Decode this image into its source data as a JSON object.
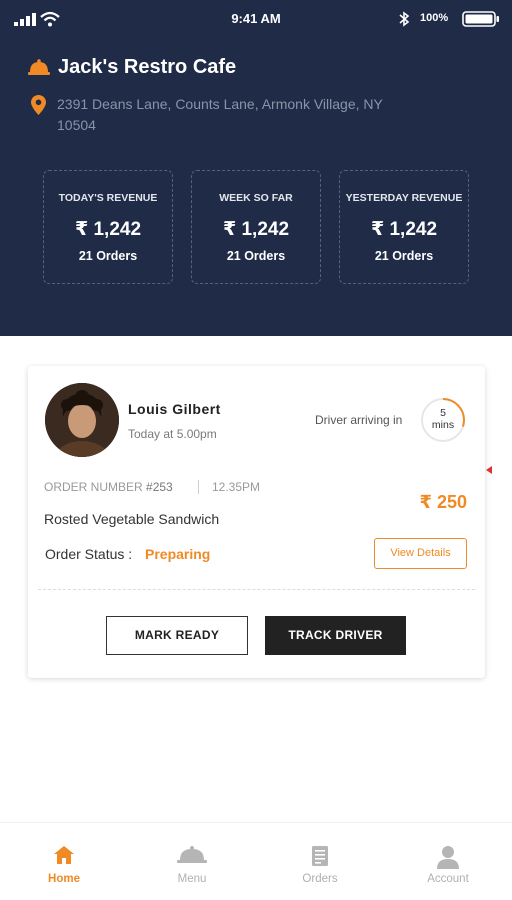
{
  "status_bar": {
    "time": "9:41 AM",
    "battery": "100%",
    "icons": [
      "signal-icon",
      "wifi-icon",
      "bluetooth-icon",
      "battery-icon"
    ]
  },
  "restaurant": {
    "name": "Jack's Restro Cafe",
    "address": "2391 Deans Lane, Counts Lane, Armonk Village, NY 10504",
    "icons": [
      "cloche-icon",
      "location-pin-icon"
    ]
  },
  "stats": [
    {
      "title": "TODAY'S REVENUE",
      "value": "₹ 1,242",
      "orders": "21 Orders"
    },
    {
      "title": "WEEK SO FAR",
      "value": "₹ 1,242",
      "orders": "21 Orders"
    },
    {
      "title": "YESTERDAY REVENUE",
      "value": "₹ 1,242",
      "orders": "21 Orders"
    }
  ],
  "order": {
    "customer_name": "Louis Gilbert",
    "time": "Today at 5.00pm",
    "driver_text": "Driver arriving in",
    "timer_value": "5",
    "timer_unit": "mins",
    "timer_progress": 0.3,
    "order_number_label": "ORDER NUMBER",
    "order_number": "#253",
    "order_time": "12.35PM",
    "item": "Rosted Vegetable Sandwich",
    "price": "₹ 250",
    "status_label": "Order Status :",
    "status_value": "Preparing",
    "view_details": "View Details",
    "mark_ready": "MARK READY",
    "track_driver": "TRACK DRIVER"
  },
  "tabs": [
    {
      "label": "Home",
      "icon": "home-icon",
      "active": true
    },
    {
      "label": "Menu",
      "icon": "cloche-icon",
      "active": false
    },
    {
      "label": "Orders",
      "icon": "receipt-icon",
      "active": false
    },
    {
      "label": "Account",
      "icon": "user-icon",
      "active": false
    }
  ],
  "colors": {
    "header_bg": "#1f2b47",
    "accent": "#f08a24",
    "dark_button": "#222222"
  }
}
